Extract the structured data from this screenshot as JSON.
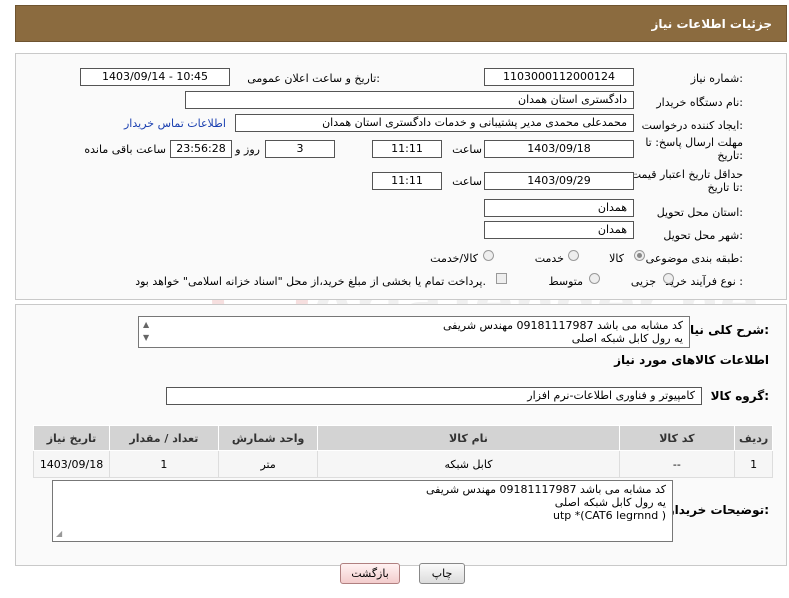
{
  "header": {
    "title": "جزئیات اطلاعات نیاز"
  },
  "labels": {
    "need_number": "شماره نیاز:",
    "announce_datetime": "تاریخ و ساعت اعلان عمومی:",
    "buyer_org": "نام دستگاه خریدار:",
    "requester": "ایجاد کننده درخواست:",
    "reply_deadline": "مهلت ارسال پاسخ: تا تاریخ:",
    "time": "ساعت",
    "day_and": "روز و",
    "hours_remaining": "ساعت باقی مانده",
    "min_price_validity": "حداقل تاریخ اعتبار قیمت: تا تاریخ:",
    "delivery_province": "استان محل تحویل:",
    "delivery_city": "شهر محل تحویل:",
    "subject_category": "طبقه بندی موضوعی:",
    "purchase_type": "نوع فرآیند خرید :",
    "need_summary": "شرح کلی نیاز:",
    "goods_info": "اطلاعات کالاهای مورد نیاز",
    "goods_group": "گروه کالا:",
    "buyer_notes": "توضیحات خریدار:"
  },
  "values": {
    "need_number": "1103000112000124",
    "announce_datetime": "1403/09/14 - 10:45",
    "buyer_org": "دادگستری استان همدان",
    "requester": "محمدعلی محمدی مدیر پشتیبانی و خدمات دادگستری استان همدان",
    "contact_link": "اطلاعات تماس خریدار",
    "reply_date": "1403/09/18",
    "reply_time": "11:11",
    "reply_days": "3",
    "reply_remaining": "23:56:28",
    "validity_date": "1403/09/29",
    "validity_time": "11:11",
    "province": "همدان",
    "city": "همدان",
    "goods_group": "کامپیوتر و فناوری اطلاعات-نرم افزار"
  },
  "category_options": [
    {
      "label": "کالا",
      "selected": true
    },
    {
      "label": "خدمت",
      "selected": false
    },
    {
      "label": "کالا/خدمت",
      "selected": false
    }
  ],
  "purchase_options": [
    {
      "label": "جزیی",
      "selected": false
    },
    {
      "label": "متوسط",
      "selected": false
    }
  ],
  "treasury_note": "پرداخت تمام یا بخشی از مبلغ خرید،از محل \"اسناد خزانه اسلامی\" خواهد بود.",
  "summary_lines": [
    "کد مشابه می باشد   09181117987 مهندس شریفی",
    "یه رول  کابل شبکه اصلی"
  ],
  "table": {
    "headers": [
      "ردیف",
      "کد کالا",
      "نام کالا",
      "واحد شمارش",
      "تعداد / مقدار",
      "تاریخ نیاز"
    ],
    "rows": [
      [
        "1",
        "--",
        "کابل شبکه",
        "متر",
        "1",
        "1403/09/18"
      ]
    ]
  },
  "notes_lines": [
    "کد مشابه می باشد   09181117987 مهندس شریفی",
    "یه رول  کابل شبکه اصلی",
    "utp *(CAT6  legrnnd  )"
  ],
  "buttons": {
    "print": "چاپ",
    "back": "بازگشت"
  },
  "watermark_text": "AriaTender.neT",
  "colors": {
    "header": "#8b6b3f",
    "link": "#1a3fb0"
  }
}
